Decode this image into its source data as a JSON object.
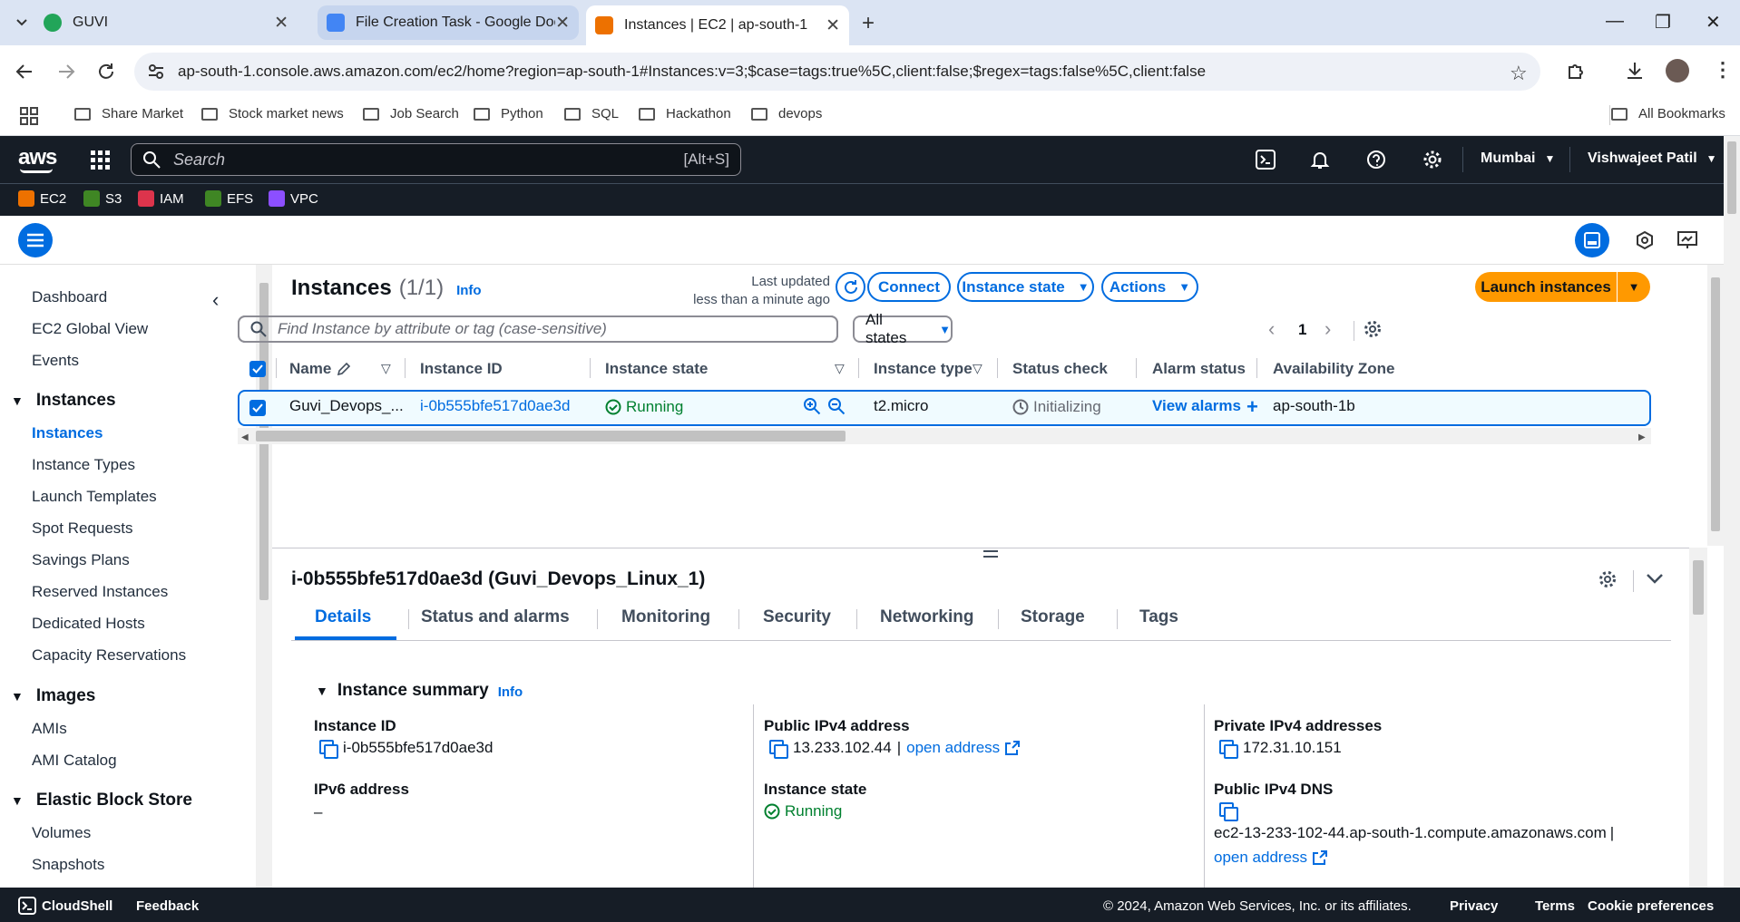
{
  "browser": {
    "tabs": [
      {
        "title": "GUVI",
        "fav_color": "#22a559"
      },
      {
        "title": "File Creation Task - Google Doc",
        "fav_color": "#4285f4"
      },
      {
        "title": "Instances | EC2 | ap-south-1",
        "fav_color": "#ed7100"
      }
    ],
    "url": "ap-south-1.console.aws.amazon.com/ec2/home?region=ap-south-1#Instances:v=3;$case=tags:true%5C,client:false;$regex=tags:false%5C,client:false",
    "bookmarks": [
      "Share Market",
      "Stock market news",
      "Job Search",
      "Python",
      "SQL",
      "Hackathon",
      "devops"
    ],
    "all_bookmarks": "All Bookmarks"
  },
  "aws": {
    "logo": "aws",
    "search_placeholder": "Search",
    "search_shortcut": "[Alt+S]",
    "region": "Mumbai",
    "user": "Vishwajeet Patil",
    "services": [
      {
        "label": "EC2",
        "color": "#ed7100"
      },
      {
        "label": "S3",
        "color": "#3f8624"
      },
      {
        "label": "IAM",
        "color": "#dd344c"
      },
      {
        "label": "EFS",
        "color": "#3f8624"
      },
      {
        "label": "VPC",
        "color": "#8c4fff"
      }
    ]
  },
  "sidebar": {
    "top": [
      "Dashboard",
      "EC2 Global View",
      "Events"
    ],
    "instances_heading": "Instances",
    "instances_items": [
      "Instances",
      "Instance Types",
      "Launch Templates",
      "Spot Requests",
      "Savings Plans",
      "Reserved Instances",
      "Dedicated Hosts",
      "Capacity Reservations"
    ],
    "images_heading": "Images",
    "images_items": [
      "AMIs",
      "AMI Catalog"
    ],
    "ebs_heading": "Elastic Block Store",
    "ebs_items": [
      "Volumes",
      "Snapshots"
    ]
  },
  "instances_panel": {
    "title": "Instances",
    "count": "(1/1)",
    "info": "Info",
    "last_updated_label": "Last updated",
    "last_updated_value": "less than a minute ago",
    "connect": "Connect",
    "instance_state": "Instance state",
    "actions": "Actions",
    "launch": "Launch instances",
    "search_placeholder": "Find Instance by attribute or tag (case-sensitive)",
    "filter": "All states",
    "page": "1",
    "columns": [
      "Name",
      "Instance ID",
      "Instance state",
      "Instance type",
      "Status check",
      "Alarm status",
      "Availability Zone"
    ],
    "row": {
      "name": "Guvi_Devops_...",
      "instance_id": "i-0b555bfe517d0ae3d",
      "state": "Running",
      "type": "t2.micro",
      "status_check": "Initializing",
      "alarm": "View alarms",
      "az": "ap-south-1b"
    }
  },
  "details": {
    "title": "i-0b555bfe517d0ae3d (Guvi_Devops_Linux_1)",
    "tabs": [
      "Details",
      "Status and alarms",
      "Monitoring",
      "Security",
      "Networking",
      "Storage",
      "Tags"
    ],
    "summary_heading": "Instance summary",
    "info": "Info",
    "instance_id_label": "Instance ID",
    "instance_id_value": "i-0b555bfe517d0ae3d",
    "public_ipv4_label": "Public IPv4 address",
    "public_ipv4_value": "13.233.102.44",
    "separator": "|",
    "open_address": "open address",
    "private_ipv4_label": "Private IPv4 addresses",
    "private_ipv4_value": "172.31.10.151",
    "ipv6_label": "IPv6 address",
    "ipv6_value": "–",
    "state_label": "Instance state",
    "state_value": "Running",
    "dns_label": "Public IPv4 DNS",
    "dns_value": "ec2-13-233-102-44.ap-south-1.compute.amazonaws.com"
  },
  "footer": {
    "cloudshell": "CloudShell",
    "feedback": "Feedback",
    "copyright": "© 2024, Amazon Web Services, Inc. or its affiliates.",
    "privacy": "Privacy",
    "terms": "Terms",
    "cookies": "Cookie preferences"
  }
}
